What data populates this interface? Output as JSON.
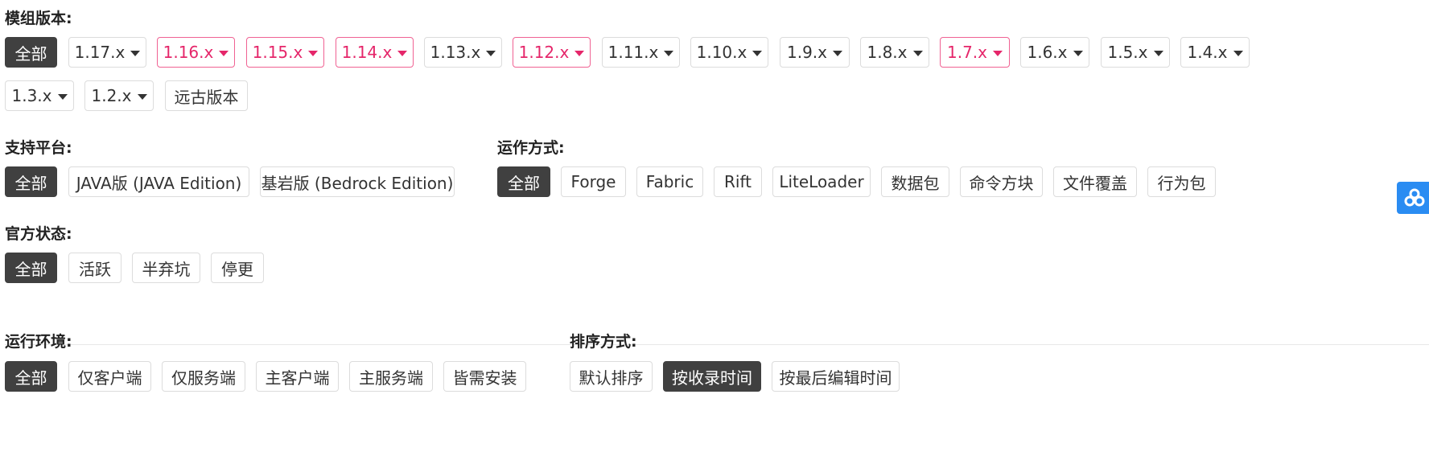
{
  "filters": {
    "version": {
      "label": "模组版本:",
      "options": [
        {
          "text": "全部"
        },
        {
          "text": "1.17.x"
        },
        {
          "text": "1.16.x"
        },
        {
          "text": "1.15.x"
        },
        {
          "text": "1.14.x"
        },
        {
          "text": "1.13.x"
        },
        {
          "text": "1.12.x"
        },
        {
          "text": "1.11.x"
        },
        {
          "text": "1.10.x"
        },
        {
          "text": "1.9.x"
        },
        {
          "text": "1.8.x"
        },
        {
          "text": "1.7.x"
        },
        {
          "text": "1.6.x"
        },
        {
          "text": "1.5.x"
        },
        {
          "text": "1.4.x"
        },
        {
          "text": "1.3.x"
        },
        {
          "text": "1.2.x"
        },
        {
          "text": "远古版本"
        }
      ]
    },
    "platform": {
      "label": "支持平台:",
      "options": [
        {
          "text": "全部"
        },
        {
          "text": "JAVA版 (JAVA Edition)"
        },
        {
          "text": "基岩版 (Bedrock Edition)"
        }
      ]
    },
    "runtime": {
      "label": "运作方式:",
      "options": [
        {
          "text": "全部"
        },
        {
          "text": "Forge"
        },
        {
          "text": "Fabric"
        },
        {
          "text": "Rift"
        },
        {
          "text": "LiteLoader"
        },
        {
          "text": "数据包"
        },
        {
          "text": "命令方块"
        },
        {
          "text": "文件覆盖"
        },
        {
          "text": "行为包"
        }
      ]
    },
    "status": {
      "label": "官方状态:",
      "options": [
        {
          "text": "全部"
        },
        {
          "text": "活跃"
        },
        {
          "text": "半弃坑"
        },
        {
          "text": "停更"
        }
      ]
    },
    "environment": {
      "label": "运行环境:",
      "options": [
        {
          "text": "全部"
        },
        {
          "text": "仅客户端"
        },
        {
          "text": "仅服务端"
        },
        {
          "text": "主客户端"
        },
        {
          "text": "主服务端"
        },
        {
          "text": "皆需安装"
        }
      ]
    },
    "sort": {
      "label": "排序方式:",
      "options": [
        {
          "text": "默认排序"
        },
        {
          "text": "按收录时间"
        },
        {
          "text": "按最后编辑时间"
        }
      ]
    }
  },
  "colors": {
    "active_bg": "#404040",
    "highlight": "#e5266a",
    "float_icon": "#2a8cf2"
  },
  "icons": {
    "float": "baidu-cloud-icon",
    "dropdown": "caret-down-icon"
  }
}
